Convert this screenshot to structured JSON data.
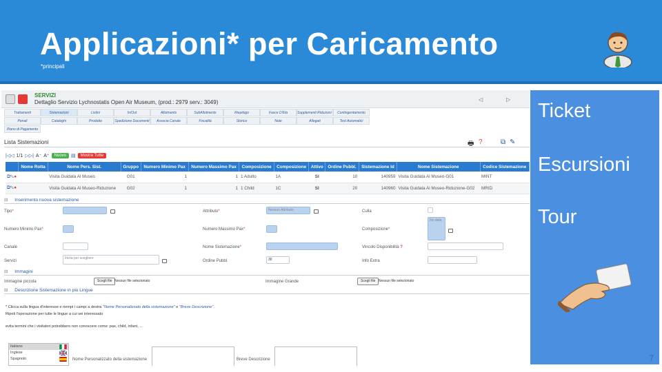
{
  "slide": {
    "title": "Applicazioni* per Caricamento",
    "subtitle": "*principali",
    "page_number": "7"
  },
  "side_panel": {
    "items": [
      "Ticket",
      "Escursioni",
      "Tour"
    ]
  },
  "colors": {
    "header_blue": "#2a8ad8",
    "panel_blue": "#4a8fe0",
    "table_header_blue": "#2a7ad0",
    "servizi_green": "#2e8b2e",
    "new_button_green": "#4caf50",
    "show_all_red": "#e53935"
  },
  "app": {
    "header": {
      "section": "SERVIZI",
      "detail": "Dettaglio Servizio Lychnostatis Open Air Museum, (prod.: 2979 serv.: 3049)"
    },
    "tabs_row1": [
      "Trattamenti",
      "Sistemazioni",
      "Listini",
      "In/Out",
      "Allotments",
      "SubAllotments",
      "Riepilogo",
      "Fasce D'Età",
      "Supplementi Riduzioni e Offerte",
      "Contingentamento"
    ],
    "tabs_row2": [
      "Penali",
      "Cataloghi",
      "Prodotto",
      "Spedizione Documenti",
      "Associa Canale",
      "Fiscalità",
      "Storico",
      "Note",
      "Allegati",
      "Test Automatici"
    ],
    "tabs_row3": [
      "Piano di Pagamento"
    ],
    "lista": {
      "title": "Lista Sistemazioni",
      "pager": "1/1",
      "new_button": "Nuovo",
      "show_all_button": "Mostra Tutte"
    },
    "table": {
      "columns": [
        "",
        "Nome Rotta",
        "Nome Pers. Sist.",
        "Gruppo",
        "Numero Minimo Pax",
        "Numero Massimo Pax",
        "Composizione",
        "Composizione",
        "Attivo",
        "Ordine Pubbl.",
        "Sistemazione Id",
        "Nome Sistemazione",
        "Codice Sistemazione"
      ],
      "rows": [
        [
          "",
          "",
          "Visita Guidata Al Museo",
          "G01",
          "1",
          "1",
          "1 Adulto",
          "1A",
          "SI",
          "10",
          "140959",
          "Visita Guidata Al Museo-G01",
          "MINT"
        ],
        [
          "",
          "",
          "Visita Guidata Al Museo-Riduzione",
          "G02",
          "1",
          "1",
          "1 Child",
          "1C",
          "SI",
          "20",
          "140960",
          "Visita Guidata Al Museo-Riduzione-G02",
          "MRID"
        ]
      ]
    },
    "insert_section": {
      "title": "Inserimento nuova sistemazione",
      "labels": {
        "tipo": "Tipo",
        "attributo": "Attributo",
        "culla": "Culla",
        "min_pax": "Numero Minimo Pax",
        "max_pax": "Numero Massimo Pax",
        "composizione": "Composizione",
        "canale": "Canale",
        "nome_sistemazione": "Nome Sistemazione",
        "vincolo": "Vincolo Disponibilità",
        "servizi": "Servizi",
        "ordine": "Ordine Pubbl.",
        "info_extra": "Info Extra"
      },
      "attributo_value": "Nessun Attributo",
      "composizione_placeholder": "No data",
      "servizi_placeholder": "Inizia per scegliere",
      "ordine_value": "30"
    },
    "images_section": {
      "title": "Immagini",
      "small_label": "Immagine piccola",
      "large_label": "Immagine Grande",
      "choose_button": "Scegli file",
      "no_file": "Nessun file selezionato"
    },
    "lang_section": {
      "title": "Descrizione Sistemazione in più Lingue",
      "line1_prefix": "* Clicca sulla lingua d'interesse e riempi i campi a destra ",
      "line1_em1": "\"Nome Personalizzato della sistemazione\"",
      "line1_mid": " e ",
      "line1_em2": "\"Breve Descrizione\"",
      "line1_suffix": ".",
      "line2": "Ripeti l'operazione per tutte le lingue a cui sei interessato",
      "line3": "evita termini che i visitatori potrebbero non conoscere come: pax, child, infant, ...",
      "languages": [
        "Italiano",
        "Inglese",
        "Spagnolo"
      ],
      "custom_name_label": "Nome Personalizzato della sistemazione",
      "short_desc_label": "Breve Descrizione"
    }
  }
}
